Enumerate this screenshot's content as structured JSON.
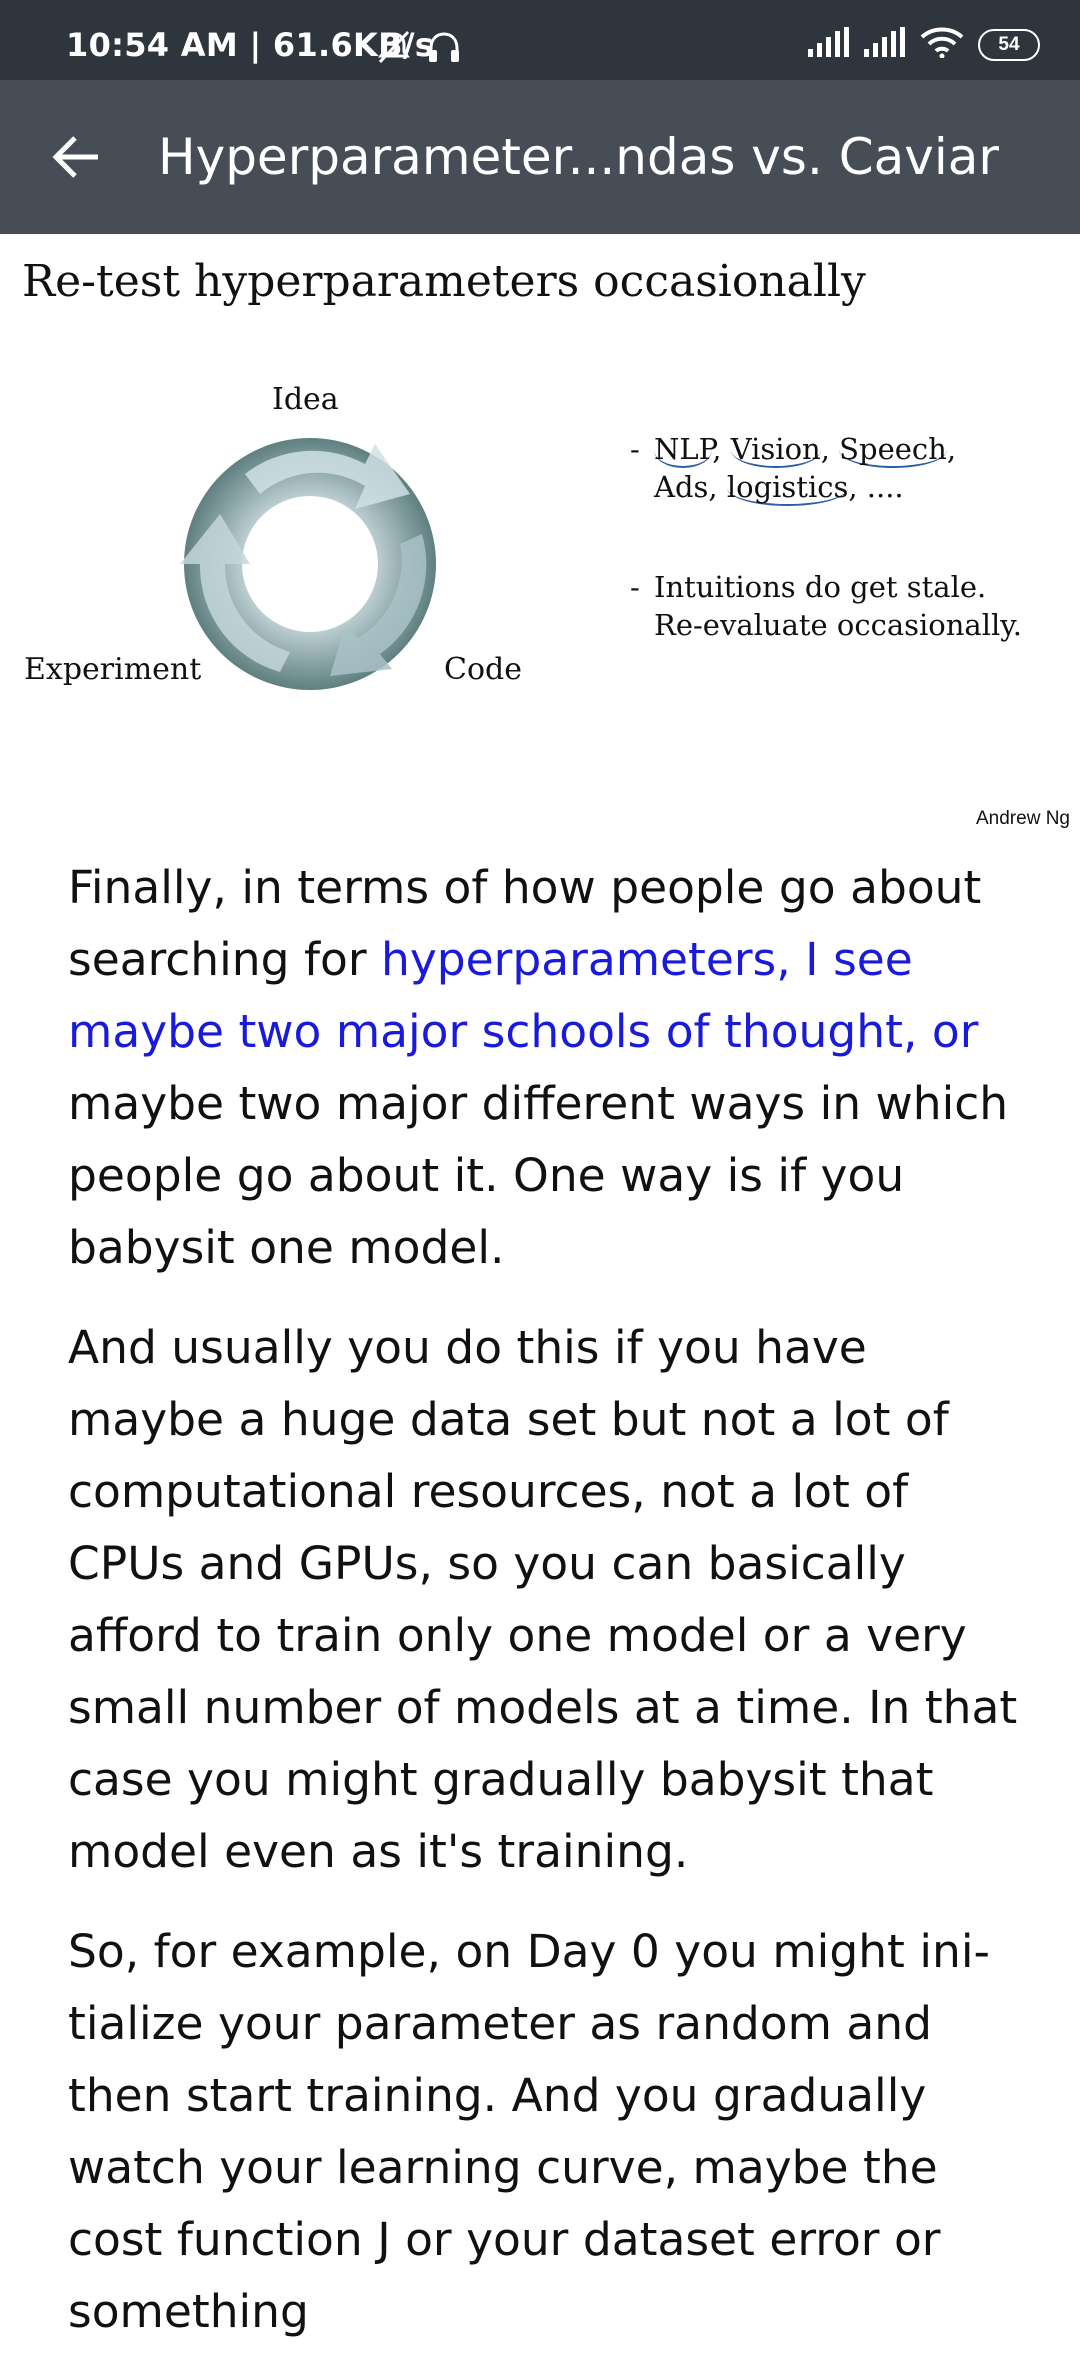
{
  "status_bar": {
    "time_text": "10:54 AM | 61.6KB/s",
    "battery": "54",
    "icons": [
      "mute-alarm-icon",
      "headset-icon",
      "signal-icon",
      "signal-icon",
      "wifi-icon",
      "battery-icon"
    ]
  },
  "app_bar": {
    "title": "Hyperparameter...ndas vs. Caviar",
    "back_icon": "arrow-back-icon"
  },
  "slide": {
    "title": "Re-test hyperparameters occasionally",
    "cycle_labels": {
      "top": "Idea",
      "left": "Experiment",
      "right": "Code"
    },
    "bullet1": {
      "line1": {
        "a": "NLP",
        "b": ", ",
        "c": "Vision",
        "d": ", ",
        "e": "Speech",
        "f": ","
      },
      "line2": {
        "a": "Ads, ",
        "b": "logistics",
        "c": ", ...."
      }
    },
    "bullet2": {
      "line1": "Intuitions do get stale.",
      "line2": "Re-evaluate occasionally."
    },
    "bullet_dash": "-",
    "credit": "Andrew Ng"
  },
  "transcript": {
    "p1_before": "Finally, in terms of how people go about searching for ",
    "p1_highlight": "hyperparameters, I see maybe two major schools of thought, or",
    "p1_after": " maybe two major different ways in which people go about it. One way is if you babysit one model.",
    "p2": "And usually you do this if you have maybe a huge data set but not a lot of computational resources, not a lot of CPUs and GPUs, so you can basically afford to train only one model or a very small number of models at a time. In that case you might gradually babysit that model even as it's training.",
    "p3": "So, for example, on Day 0 you might ini­tialize your parameter as random and then start training. And you gradually watch your learning curve, maybe the cost func­tion J or your dataset error or something"
  },
  "colors": {
    "status_bar": "#2f353d",
    "app_bar": "#474d56",
    "highlight": "#1a1adb"
  }
}
